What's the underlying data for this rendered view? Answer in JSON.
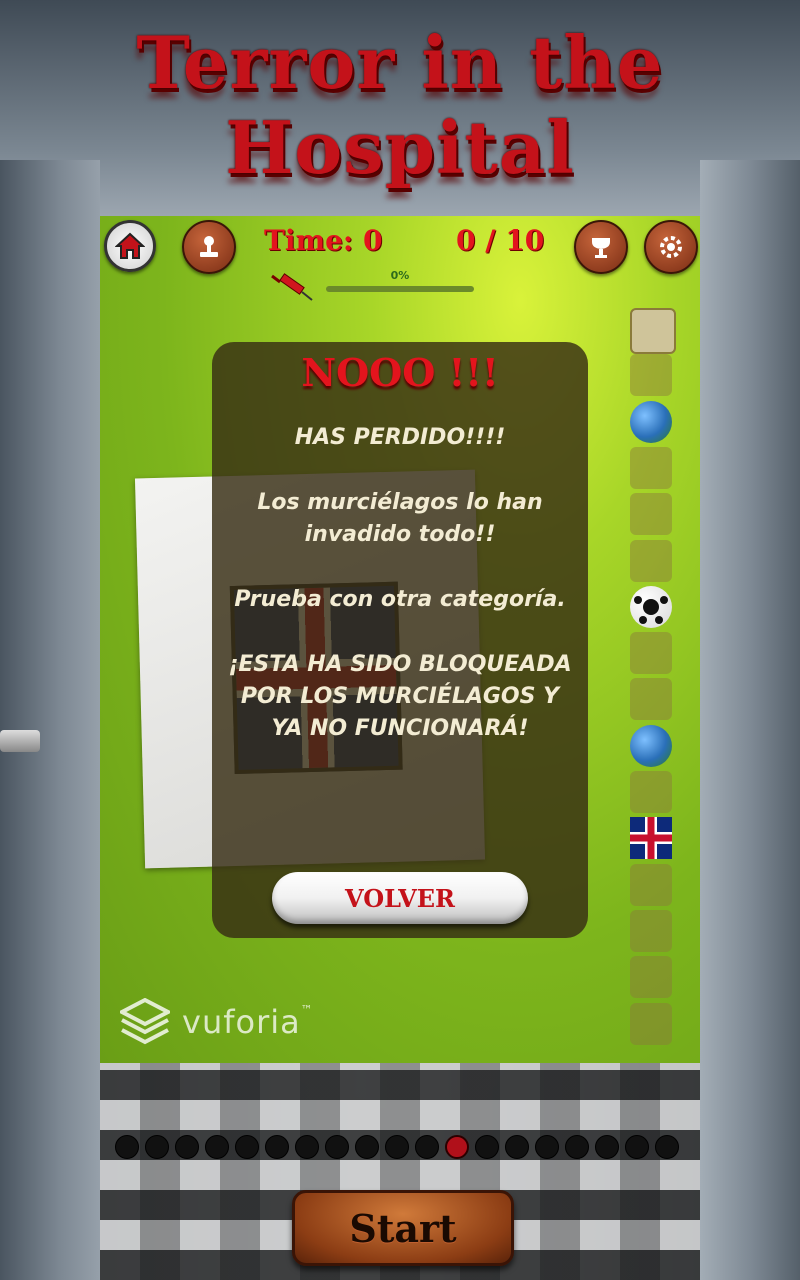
{
  "app": {
    "title": "Terror in the Hospital"
  },
  "hud": {
    "time_label": "Time: 0",
    "score_label": "0 / 10",
    "progress_label": "0%",
    "progress_value": 0
  },
  "dialog": {
    "title": "NOOO !!!",
    "lines": [
      "HAS PERDIDO!!!!",
      "Los murciélagos lo han invadido todo!!",
      "Prueba con otra categoría.",
      "¡ESTA HA SIDO BLOQUEADA POR LOS MURCIÉLAGOS Y YA NO FUNCIONARÁ!"
    ],
    "button_label": "VOLVER"
  },
  "categories": [
    {
      "icon": "mona-lisa-icon"
    },
    {
      "icon": "geography-map-icon"
    },
    {
      "icon": "globe-icon"
    },
    {
      "icon": "rocks-icon"
    },
    {
      "icon": "science-icon"
    },
    {
      "icon": "food-question-icon"
    },
    {
      "icon": "soccer-ball-icon"
    },
    {
      "icon": "tools-icon"
    },
    {
      "icon": "history-helmet-icon"
    },
    {
      "icon": "earth-icon"
    },
    {
      "icon": "book-icon"
    },
    {
      "icon": "uk-flag-icon"
    },
    {
      "icon": "superhero-icon"
    },
    {
      "icon": "movie-camera-icon"
    },
    {
      "icon": "music-notes-icon"
    },
    {
      "icon": "videogame-icon"
    }
  ],
  "branding": {
    "logo_text": "vuforia",
    "logo_tm": "™"
  },
  "pager": {
    "count": 19,
    "active_index": 11
  },
  "start": {
    "label": "Start"
  },
  "colors": {
    "title_red": "#c4121a",
    "hud_red": "#e3141d",
    "panel_green": "#a8d628",
    "button_brown": "#8c3d14",
    "active_dot": "#b0101a"
  }
}
